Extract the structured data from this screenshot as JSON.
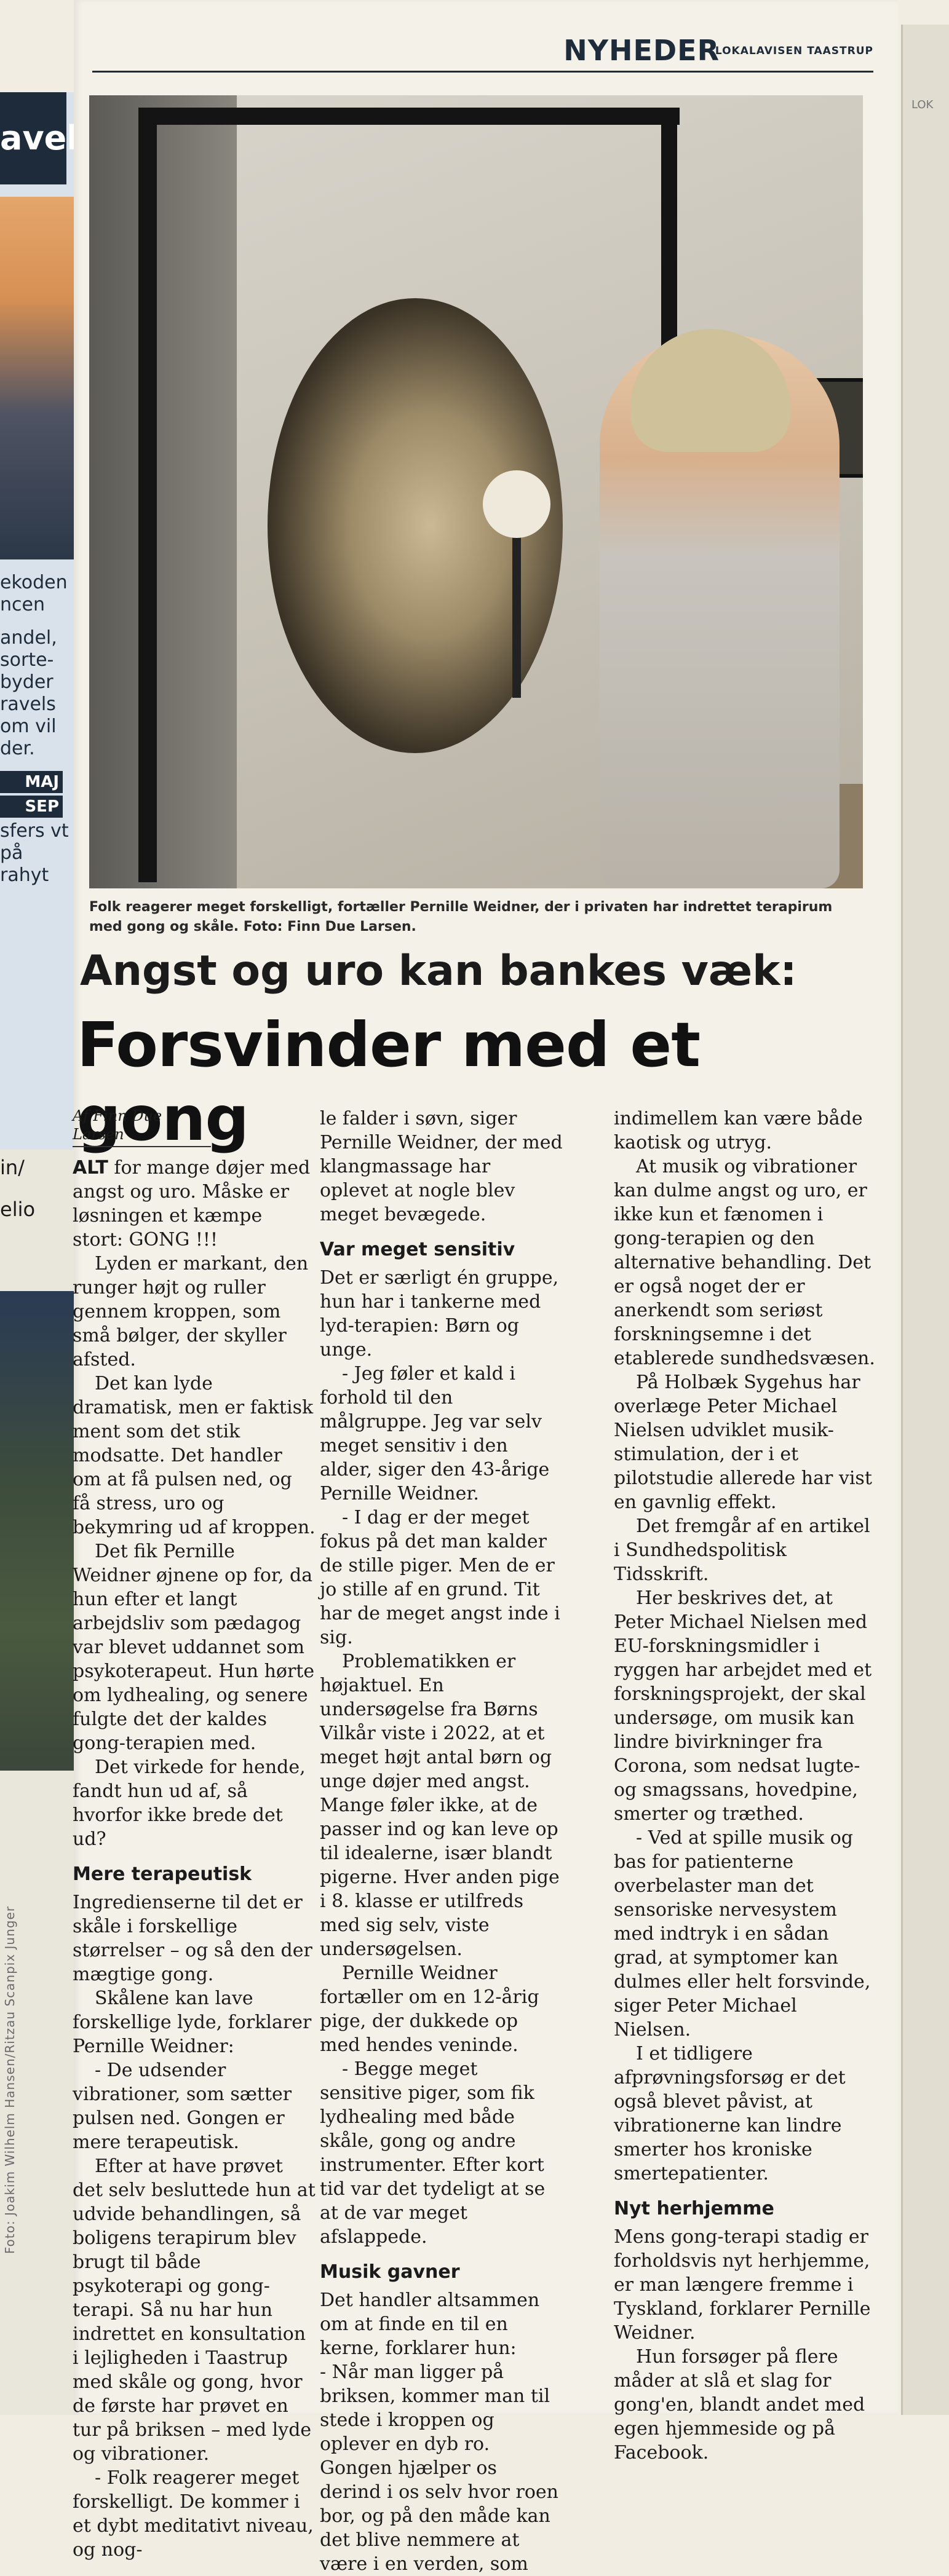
{
  "left_page": {
    "ad_word": "avel",
    "ad_lines": [
      "ekoden",
      "ncen"
    ],
    "snippet": "andel, sorte- byder ravels om vil der.",
    "badges": [
      "MAJ",
      "SEP"
    ],
    "snippet2": "sfers vt på rahyt",
    "snippet3": "in/",
    "snippet4": "elio",
    "photo_credit": "Foto: Joakim Wilhelm Hansen/Ritzau Scanpix Junger"
  },
  "right_page": {
    "snippet": "LOK"
  },
  "header": {
    "section": "NYHEDER",
    "paper": "LOKALAVISEN TAASTRUP"
  },
  "caption": "Folk reagerer meget forskelligt, fortæller Pernille Weidner, der i privaten har indrettet terapirum med gong og skåle. Foto: Finn Due Larsen.",
  "kicker": "Angst og uro kan bankes væk:",
  "headline": "Forsvinder med et gong",
  "byline": "Af Finn Due Larsen",
  "col1": {
    "lead_cap": "ALT",
    "p1": "for mange døjer med angst og uro. Måske er løsningen et kæmpe stort: GONG !!!",
    "p2": "Lyden er markant, den runger højt og ruller gennem kroppen, som små bølger, der skyller afsted.",
    "p3": "Det kan lyde dramatisk, men er faktisk ment som det stik modsatte. Det handler om at få pulsen ned, og få stress, uro og bekymring ud af kroppen.",
    "p4": "Det fik Pernille Weidner øjnene op for, da hun efter et langt arbejdsliv som pædagog var blevet uddannet som psykoterapeut. Hun hørte om lydhealing, og senere fulgte det der kaldes gong-terapien med.",
    "p5": "Det virkede for hende, fandt hun ud af, så hvorfor ikke brede det ud?",
    "h1": "Mere terapeutisk",
    "p6": "Ingredienserne til det er skåle i forskellige størrelser – og så den der mægtige gong.",
    "p7": "Skålene kan lave forskellige lyde, forklarer Pernille Weidner:",
    "p8": "- De udsender vibrationer, som sætter pulsen ned. Gongen er mere terapeutisk.",
    "p9": "Efter at have prøvet det selv besluttede hun at udvide behandlingen, så boligens terapirum blev brugt til både psykoterapi og gong-terapi. Så nu har hun indrettet en konsultation i lejligheden i Taastrup med skåle og gong, hvor de første har prøvet en tur på briksen – med lyde og vibrationer.",
    "p10": "- Folk reagerer meget forskelligt. De kommer i et dybt meditativt niveau, og nog-"
  },
  "col2": {
    "p1": "le falder i søvn, siger Pernille Weidner, der med klangmassage har oplevet at nogle blev meget bevægede.",
    "h1": "Var meget sensitiv",
    "p2": "Det er særligt én gruppe, hun har i tankerne med lyd-terapien: Børn og unge.",
    "p3": "- Jeg føler et kald i forhold til den målgruppe. Jeg var selv meget sensitiv i den alder, siger den 43-årige Pernille Weidner.",
    "p4": "- I dag er der meget fokus på det man kalder de stille piger. Men de er jo stille af en grund. Tit har de meget angst inde i sig.",
    "p5": "Problematikken er højaktuel. En undersøgelse fra Børns Vilkår viste i 2022, at et meget højt antal børn og unge døjer med angst. Mange føler ikke, at de passer ind og kan leve op til idealerne, især blandt pigerne. Hver anden pige i 8. klasse er utilfreds med sig selv, viste undersøgelsen.",
    "p6": "Pernille Weidner fortæller om en 12-årig pige, der dukkede op med hendes veninde.",
    "p7": "- Begge meget sensitive piger, som fik lydhealing med både skåle, gong og andre instrumenter. Efter kort tid var det tydeligt at se at de var meget afslappede.",
    "h2": "Musik gavner",
    "p8": "Det handler altsammen om at finde en til en kerne, forklarer hun:",
    "p9": "- Når man ligger på briksen, kommer man til stede i kroppen og oplever en dyb ro. Gongen hjælper os derind i os selv hvor roen bor, og på den måde kan det blive nemmere at være i en verden, som"
  },
  "col3": {
    "p1": "indimellem kan være både kaotisk og utryg.",
    "p2": "At musik og vibrationer kan dulme angst og uro, er ikke kun et fænomen i gong-terapien og den alternative behandling. Det er også noget der er anerkendt som seriøst forskningsemne i det etablerede sundhedsvæsen.",
    "p3": "På Holbæk Sygehus har overlæge Peter Michael Nielsen udviklet musik-stimulation, der i et pilotstudie allerede har vist en gavnlig effekt.",
    "p4": "Det fremgår af en artikel i Sundhedspolitisk Tidsskrift.",
    "p5": "Her beskrives det, at Peter Michael Nielsen med EU-forskningsmidler i ryggen har arbejdet med et forskningsprojekt, der skal undersøge, om musik kan lindre bivirkninger fra Corona, som nedsat lugte- og smagssans, hovedpine, smerter og træthed.",
    "p6": "- Ved at spille musik og bas for patienterne overbelaster man det sensoriske nervesystem med indtryk i en sådan grad, at symptomer kan dulmes eller helt forsvinde, siger Peter Michael Nielsen.",
    "p7": "I et tidligere afprøvningsforsøg er det også blevet påvist, at vibrationerne kan lindre smerter hos kroniske smertepatienter.",
    "h1": "Nyt herhjemme",
    "p8": "Mens gong-terapi stadig er forholdsvis nyt herhjemme, er man længere fremme i Tyskland, forklarer Pernille Weidner.",
    "p9": "Hun forsøger på flere måder at slå et slag for gong'en, blandt andet med egen hjemmeside og på Facebook."
  }
}
